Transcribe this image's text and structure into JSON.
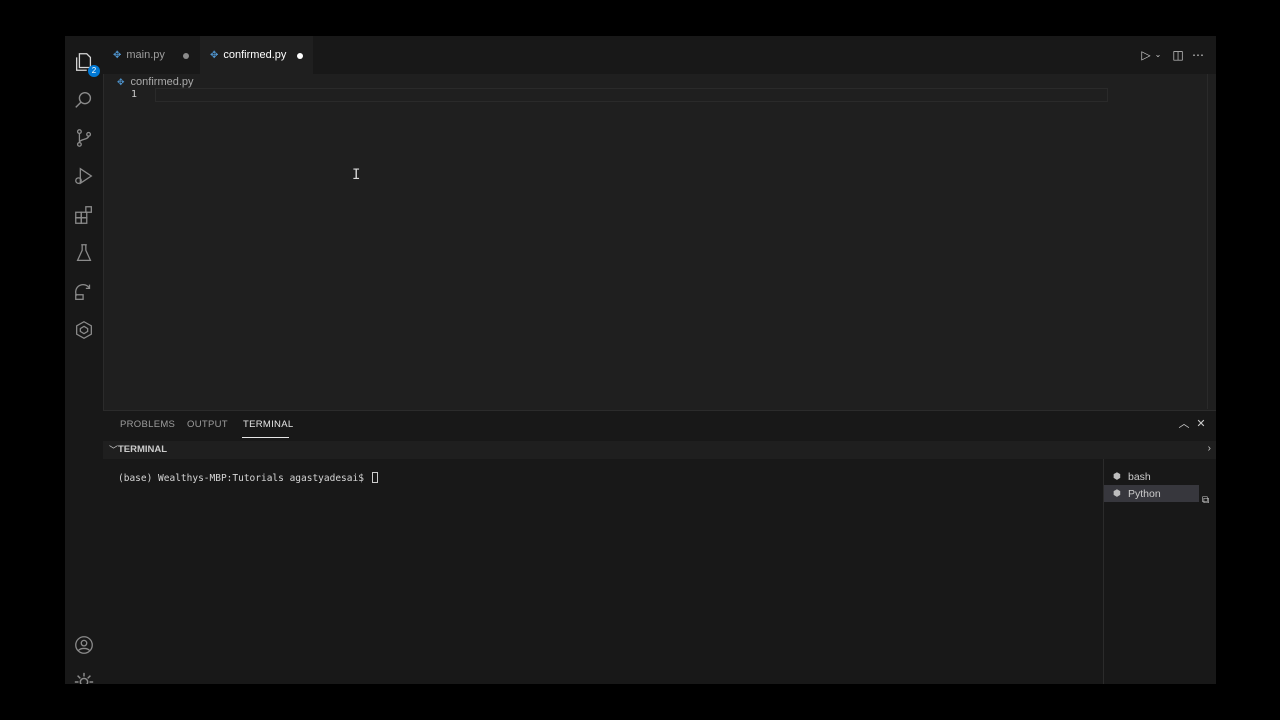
{
  "activity": {
    "explorer_badge": "2",
    "icons": [
      "files-icon",
      "search-icon",
      "source-control-icon",
      "run-debug-icon",
      "extensions-icon",
      "testing-icon",
      "remote-explorer-icon",
      "docker-icon",
      "account-icon",
      "settings-gear-icon"
    ]
  },
  "tabs": [
    {
      "label": "main.py",
      "modified": true,
      "active": false
    },
    {
      "label": "confirmed.py",
      "modified": true,
      "active": true
    }
  ],
  "breadcrumb": {
    "file": "confirmed.py"
  },
  "editor": {
    "line_number": "1",
    "content": ""
  },
  "panel": {
    "tabs": [
      "PROBLEMS",
      "OUTPUT",
      "TERMINAL"
    ],
    "active_tab": "TERMINAL",
    "section_title": "TERMINAL",
    "prompt": "(base) Wealthys-MBP:Tutorials agastyadesai$ ",
    "terminals": [
      {
        "label": "bash",
        "selected": false
      },
      {
        "label": "Python",
        "selected": true
      }
    ]
  },
  "colors": {
    "accent": "#0078d4",
    "python_icon": "#4e94ce",
    "editor_bg": "#1f1f1f",
    "sidebar_bg": "#181818"
  }
}
